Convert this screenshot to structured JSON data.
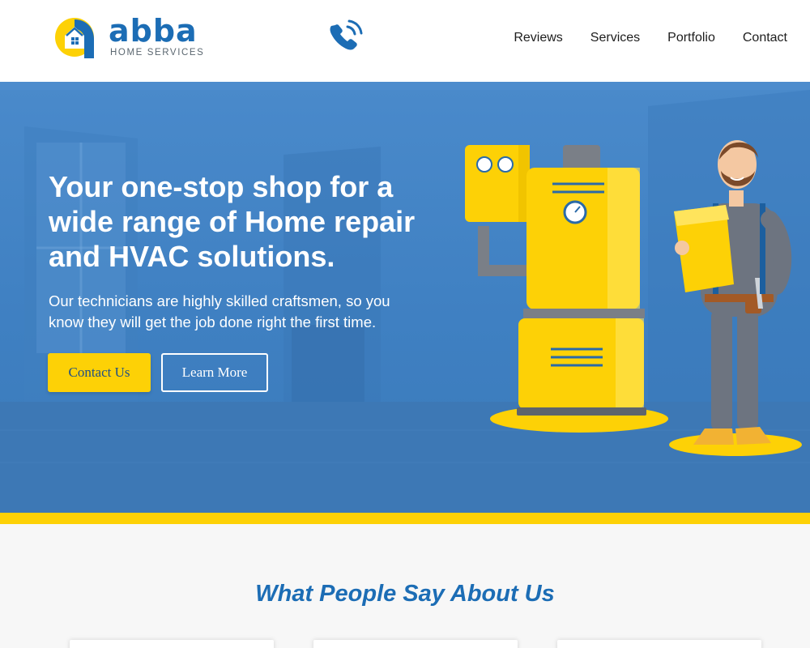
{
  "brand": {
    "name": "abba",
    "tagline": "HOME SERVICES",
    "primary_color": "#1c6db5",
    "accent_color": "#fdd106"
  },
  "header": {
    "phone_icon": "phone-ringing-icon",
    "nav": [
      "Reviews",
      "Services",
      "Portfolio",
      "Contact"
    ]
  },
  "hero": {
    "title": "Your one-stop shop for a wide range of Home repair and HVAC solutions.",
    "text": "Our technicians are highly skilled craftsmen, so you know they will get the job done right the first time.",
    "primary_button": "Contact Us",
    "secondary_button": "Learn More",
    "illustration": "technician-with-furnace-illustration"
  },
  "reviews": {
    "title": "What People Say About Us",
    "card_count": 3
  }
}
